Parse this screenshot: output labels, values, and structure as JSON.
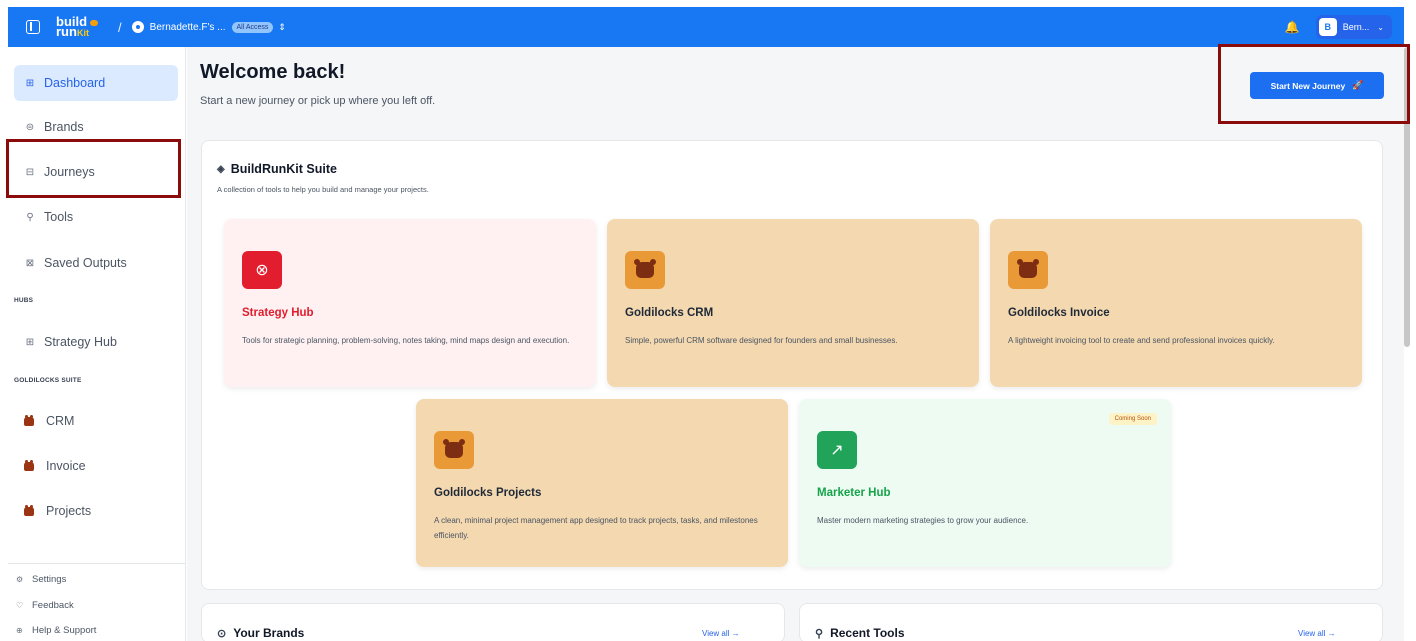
{
  "topbar": {
    "logo_line1": "build",
    "logo_line2": "run",
    "logo_kit": "Kit",
    "separator": "/",
    "workspace_name": "Bernadette.F's ...",
    "workspace_badge": "All Access",
    "workspace_chevron": "⇕",
    "bell_icon": "🔔",
    "user_initial": "B",
    "user_name": "Bern...",
    "user_chevron": "⌄"
  },
  "sidebar": {
    "items": [
      {
        "label": "Dashboard",
        "icon": "⊞"
      },
      {
        "label": "Brands",
        "icon": "⊜"
      },
      {
        "label": "Journeys",
        "icon": "⊟"
      },
      {
        "label": "Tools",
        "icon": "⚲"
      },
      {
        "label": "Saved Outputs",
        "icon": "⊠"
      }
    ],
    "section_hub": "HUBS",
    "hub_items": [
      {
        "label": "Strategy Hub",
        "icon": "⊞"
      }
    ],
    "section_goldilocks": "GOLDILOCKS SUITE",
    "goldilocks_items": [
      {
        "label": "CRM"
      },
      {
        "label": "Invoice"
      },
      {
        "label": "Projects"
      }
    ],
    "footer": [
      {
        "label": "Settings",
        "icon": "⚙"
      },
      {
        "label": "Feedback",
        "icon": "♡"
      },
      {
        "label": "Help & Support",
        "icon": "⊕"
      }
    ]
  },
  "main": {
    "welcome_title": "Welcome back!",
    "welcome_subtitle": "Start a new journey or pick up where you left off.",
    "start_button_label": "Start New Journey",
    "start_button_icon": "🚀",
    "suite": {
      "icon": "◈",
      "title": "BuildRunKit Suite",
      "subtitle": "A collection of tools to help you build and manage your projects.",
      "cards": [
        {
          "title": "Strategy Hub",
          "desc": "Tools for strategic planning, problem-solving, notes taking, mind maps design and execution.",
          "icon": "⊗"
        },
        {
          "title": "Goldilocks CRM",
          "desc": "Simple, powerful CRM software designed for founders and small businesses."
        },
        {
          "title": "Goldilocks Invoice",
          "desc": "A lightweight invoicing tool to create and send professional invoices quickly."
        },
        {
          "title": "Goldilocks Projects",
          "desc": "A clean, minimal project management app designed to track projects, tasks, and milestones efficiently."
        },
        {
          "title": "Marketer Hub",
          "desc": "Master modern marketing strategies to grow your audience.",
          "badge": "Coming Soon",
          "icon": "↗"
        }
      ]
    },
    "your_brands": {
      "title": "Your Brands",
      "icon": "⊙",
      "view_all": "View all →"
    },
    "recent_tools": {
      "title": "Recent Tools",
      "icon": "⚲",
      "view_all": "View all →"
    }
  },
  "colors": {
    "topbar": "#1877f2",
    "accent": "#1d6ff2",
    "highlight": "#8b0a0a",
    "strategy_red": "#e11d2e",
    "goldilocks_tan": "#f3d8b0",
    "marketer_green": "#16a34a"
  }
}
